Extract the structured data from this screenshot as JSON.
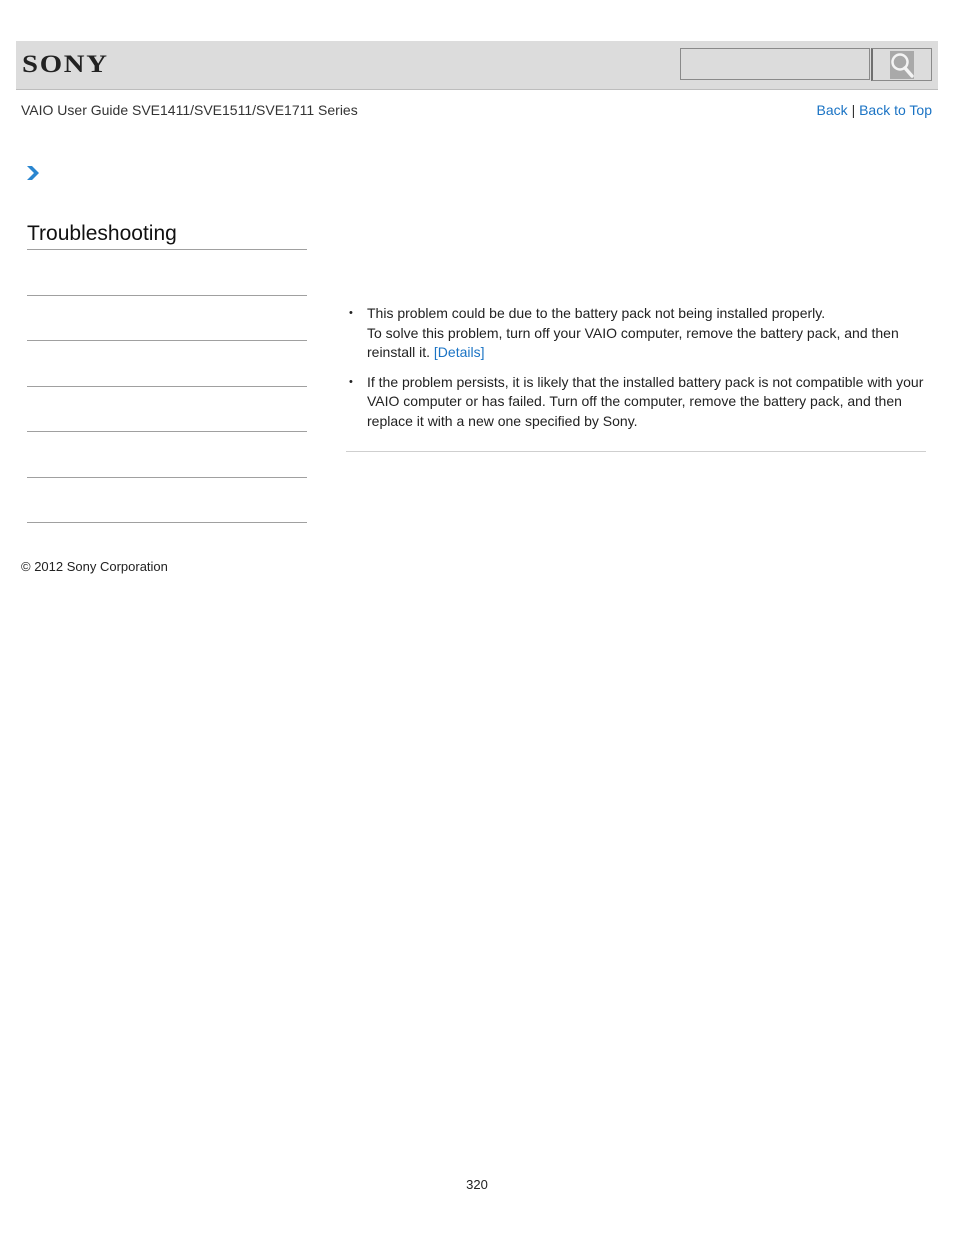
{
  "header": {
    "logo": "SONY",
    "search": {
      "value": "",
      "placeholder": ""
    },
    "search_icon": "magnifier-icon"
  },
  "nav": {
    "guide_title": "VAIO User Guide SVE1411/SVE1511/SVE1711 Series",
    "back": "Back",
    "separator": "|",
    "back_to_top": "Back to Top"
  },
  "sidebar": {
    "title": "Troubleshooting",
    "items": [
      "",
      "",
      "",
      "",
      "",
      ""
    ]
  },
  "content": {
    "bullets": [
      {
        "line1": "This problem could be due to the battery pack not being installed properly.",
        "line2": "To solve this problem, turn off your VAIO computer, remove the battery pack, and then reinstall it.",
        "link": "[Details]"
      },
      {
        "text": "If the problem persists, it is likely that the installed battery pack is not compatible with your VAIO computer or has failed. Turn off the computer, remove the battery pack, and then replace it with a new one specified by Sony."
      }
    ],
    "bullet_glyph": "•"
  },
  "footer": {
    "copyright": "© 2012 Sony Corporation",
    "page_number": "320"
  },
  "colors": {
    "link": "#1a73c4",
    "header_bg": "#dcdcdc",
    "chevron": "#2a86d0"
  }
}
